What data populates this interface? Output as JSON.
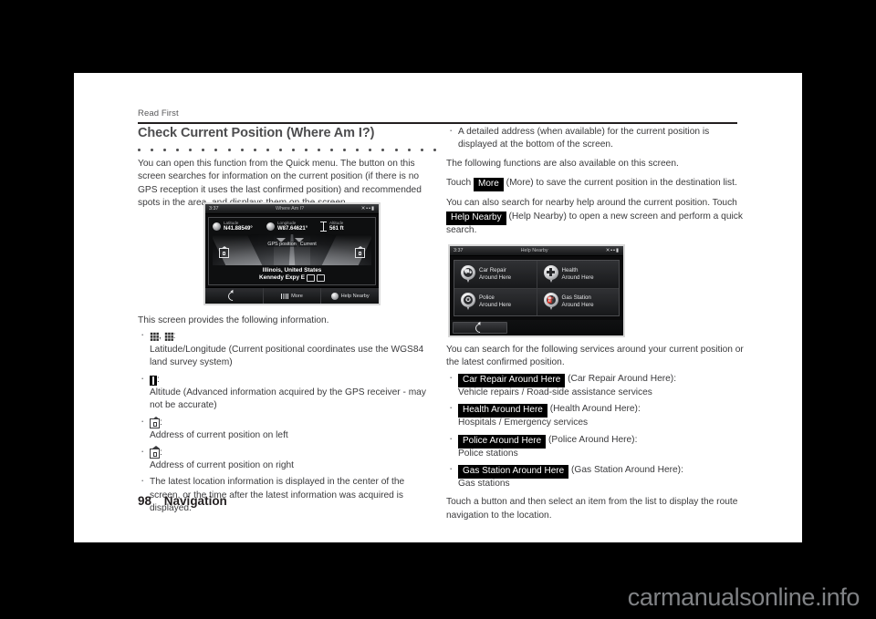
{
  "page": {
    "running_head": "Read First",
    "chapter_title": "Check Current Position (Where Am I?)",
    "folio_number": "98",
    "folio_section": "Navigation",
    "watermark": "carmanualsonline.info"
  },
  "left_column": {
    "intro": "You can open this function from the Quick menu. The button on this screen searches for information on the current position (if there is no GPS reception it uses the last confirmed position) and recommended spots in the area, and displays them on the screen.",
    "screen_caption": "This screen provides the following information.",
    "items": [
      {
        "icon": "latlon-grid-icon",
        "label": "",
        "desc": "Latitude/Longitude (Current positional coordinates use the WGS84 land survey system)"
      },
      {
        "icon": "altitude-icon",
        "label": "",
        "desc": "Altitude (Advanced information acquired by the GPS receiver - may not be accurate)"
      },
      {
        "icon": "home-left-icon",
        "label": "",
        "desc": "Address of current position on left"
      },
      {
        "icon": "home-right-icon",
        "label": "",
        "desc": "Address of current position on right"
      },
      {
        "icon": "",
        "label": "",
        "desc": "The latest location information is displayed in the center of the screen, or the time after the latest information was acquired is displayed."
      }
    ]
  },
  "right_column": {
    "bullet_detailed_address": "A detailed address (when available) for the current position is displayed at the bottom of the screen.",
    "functions_intro": "The following functions are also available on this screen.",
    "more_line_prefix": "Touch",
    "more_key": "More",
    "more_line_suffix": "(More) to save the current position in the destination list.",
    "help_intro": "You can also search for nearby help around the current position. Touch",
    "help_key": "Help Nearby",
    "help_line_suffix": "(Help Nearby) to open a new screen and perform a quick search.",
    "services_intro": "You can search for the following services around your current position or the latest confirmed position.",
    "services": [
      {
        "key": "Car Repair Around Here",
        "paren": "(Car Repair Around Here):",
        "desc": "Vehicle repairs / Road-side assistance services"
      },
      {
        "key": "Health Around Here",
        "paren": "(Health Around Here):",
        "desc": "Hospitals / Emergency services"
      },
      {
        "key": "Police Around Here",
        "paren": "(Police Around Here):",
        "desc": "Police stations"
      },
      {
        "key": "Gas Station Around Here",
        "paren": "(Gas Station Around Here):",
        "desc": "Gas stations"
      }
    ],
    "closing": "Touch a button and then select an item from the list to display the route navigation to the location."
  },
  "screenshot_where_am_i": {
    "clock": "3:37",
    "title": "Where Am I?",
    "status": "✕▪▪▮",
    "latitude_label": "Latitude",
    "latitude_value": "N41.88549°",
    "longitude_label": "Longitude",
    "longitude_value": "W87.64621°",
    "altitude_label": "Altitude",
    "altitude_value": "561 ft",
    "map_label_gps": "GPS position",
    "map_label_current": "Current",
    "address_line1": "Illinois, United States",
    "address_line2": "Kennedy Expy E",
    "bottom_back": "",
    "bottom_more": "More",
    "bottom_help": "Help Nearby"
  },
  "screenshot_help_nearby": {
    "clock": "3:37",
    "title": "Help Nearby",
    "status": "✕▪▪▮",
    "tiles": [
      {
        "icon": "car-repair-icon",
        "line1": "Car Repair",
        "line2": "Around Here"
      },
      {
        "icon": "health-cross-icon",
        "line1": "Health",
        "line2": "Around Here"
      },
      {
        "icon": "police-badge-icon",
        "line1": "Police",
        "line2": "Around Here"
      },
      {
        "icon": "gas-pump-icon",
        "line1": "Gas Station",
        "line2": "Around Here"
      }
    ],
    "back_label": ""
  }
}
